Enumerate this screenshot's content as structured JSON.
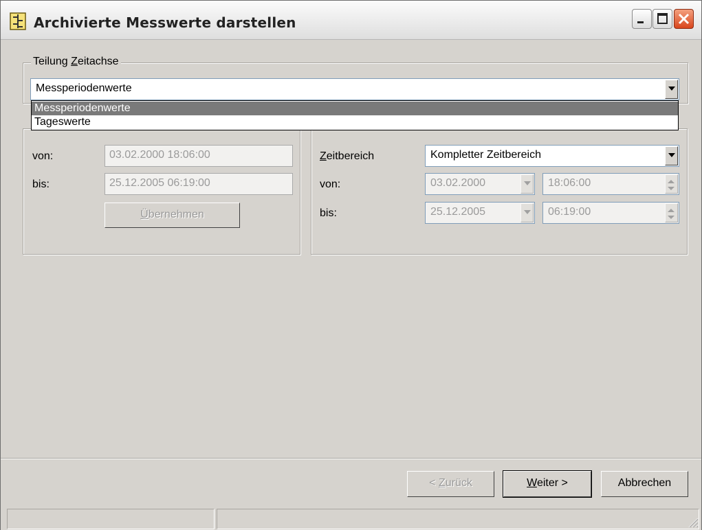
{
  "window": {
    "title": "Archivierte Messwerte darstellen",
    "icon": "app-icon",
    "controls": [
      "minimize-icon",
      "maximize-icon",
      "close-icon"
    ]
  },
  "teilung": {
    "label_prefix": "Teilung ",
    "label_accel": "Z",
    "label_rest": "eitachse",
    "selected": "Messperiodenwerte",
    "options": [
      "Messperiodenwerte",
      "Tageswerte"
    ]
  },
  "left_group": {
    "von_label": "von:",
    "von_value": "03.02.2000  18:06:00",
    "bis_label": "bis:",
    "bis_value": "25.12.2005  06:19:00",
    "apply_accel": "Ü",
    "apply_rest": "bernehmen"
  },
  "right_group": {
    "zeitbereich_accel": "Z",
    "zeitbereich_rest": "eitbereich",
    "zeitbereich_value": "Kompletter Zeitbereich",
    "von_label": "von:",
    "von_date": "03.02.2000",
    "von_time": "18:06:00",
    "bis_label": "bis:",
    "bis_date": "25.12.2005",
    "bis_time": "06:19:00"
  },
  "footer": {
    "back_prefix": "< ",
    "back_accel": "Z",
    "back_rest": "urück",
    "next_accel": "W",
    "next_rest": "eiter >",
    "cancel_label": "Abbrechen"
  },
  "colors": {
    "dialog_bg": "#d6d3ce",
    "selection_bg": "#7a7a7a",
    "disabled_text": "#9a9a9a",
    "close_button": "#d9461d"
  }
}
